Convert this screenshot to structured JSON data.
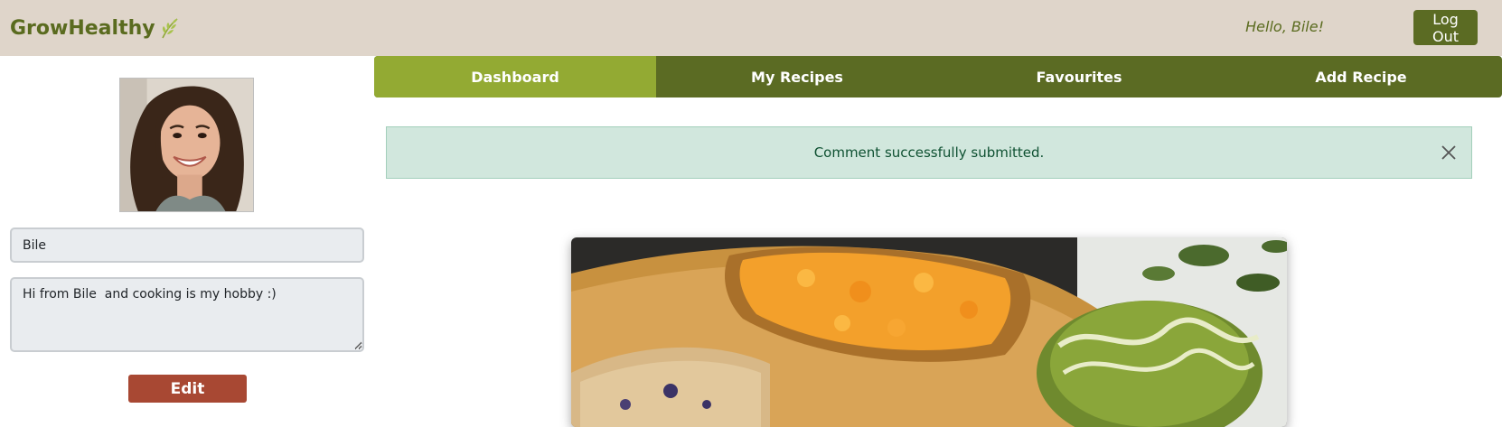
{
  "header": {
    "brand": "GrowHealthy",
    "greeting": "Hello, Bile!",
    "logout_label": "Log Out"
  },
  "profile": {
    "name": "Bile",
    "bio": "Hi from Bile  and cooking is my hobby :)",
    "edit_label": "Edit"
  },
  "nav": {
    "items": [
      {
        "label": "Dashboard",
        "active": true
      },
      {
        "label": "My Recipes"
      },
      {
        "label": "Favourites"
      },
      {
        "label": "Add Recipe"
      }
    ]
  },
  "alert": {
    "message": "Comment successfully submitted."
  },
  "icons": {
    "brand": "leaf-icon",
    "close": "close-icon"
  },
  "colors": {
    "topbar_bg": "#dfd5ca",
    "brand_green": "#5a6b1f",
    "nav_bg": "#5b6b23",
    "nav_active": "#93aa33",
    "alert_bg": "#d1e7dd",
    "edit_button": "#a84833"
  }
}
